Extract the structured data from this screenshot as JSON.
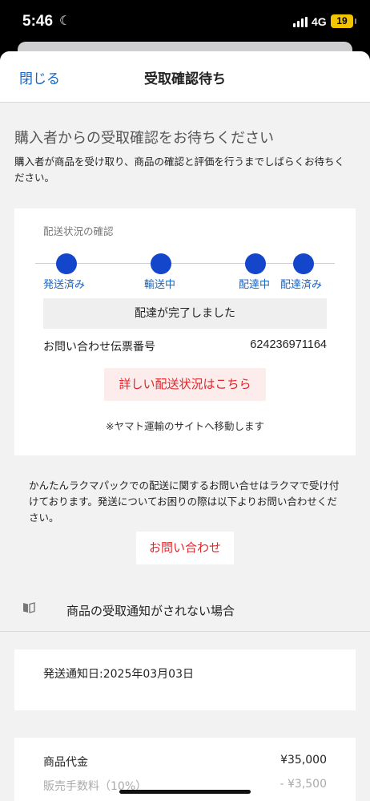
{
  "status_bar": {
    "time": "5:46",
    "network": "4G",
    "battery": "19"
  },
  "nav": {
    "close_label": "閉じる",
    "title": "受取確認待ち"
  },
  "heading": "購入者からの受取確認をお待ちください",
  "description": "購入者が商品を受け取り、商品の確認と評価を行うまでしばらくお待ちください。",
  "delivery": {
    "section_label": "配送状況の確認",
    "steps": [
      "発送済み",
      "輸送中",
      "配達中",
      "配達済み"
    ],
    "status_message": "配達が完了しました",
    "tracking_label": "お問い合わせ伝票番号",
    "tracking_number": "624236971164",
    "detail_button": "詳しい配送状況はこちら",
    "note": "※ヤマト運輸のサイトへ移動します"
  },
  "contact": {
    "text": "かんたんラクマパックでの配送に関するお問い合せはラクマで受け付けております。発送についてお困りの際は以下よりお問い合わせください。",
    "button": "お問い合わせ"
  },
  "receipt_notice": {
    "icon": "book-icon",
    "label": "商品の受取通知がされない場合"
  },
  "shipping": {
    "date_text": "発送通知日:2025年03月03日"
  },
  "pricing": {
    "rows": [
      {
        "label": "商品代金",
        "value": "¥35,000"
      },
      {
        "label": "販売手数料（10%）",
        "value": "- ¥3,500"
      }
    ]
  },
  "colors": {
    "accent_blue": "#1446cc",
    "link_blue": "#1666c8",
    "cta_red": "#e0262b",
    "cta_bg": "#fdecec"
  }
}
